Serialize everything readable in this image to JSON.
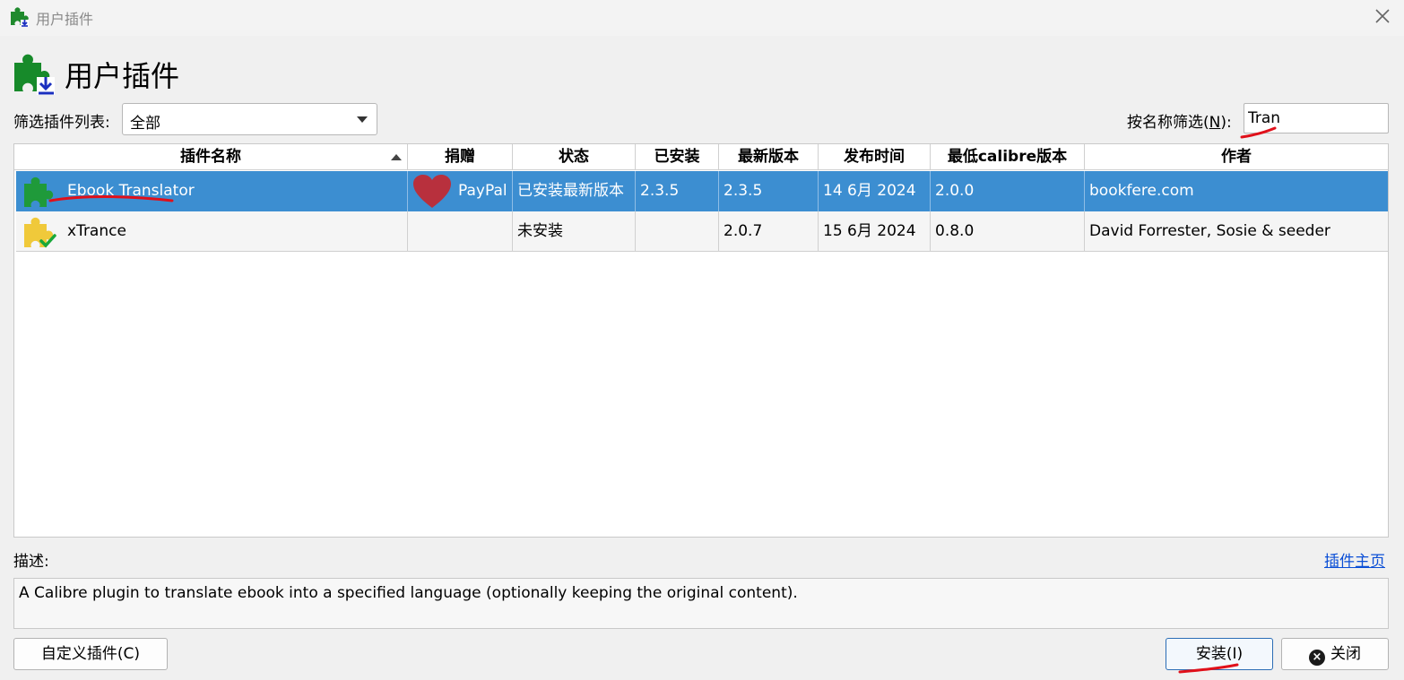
{
  "window": {
    "title": "用户插件",
    "close_icon": "close-icon"
  },
  "header": {
    "title": "用户插件",
    "icon": "puzzle-download-icon"
  },
  "filter": {
    "label": "筛选插件列表:",
    "selected": "全部"
  },
  "name_filter": {
    "label_prefix": "按名称筛选(",
    "label_key": "N",
    "label_suffix": "):",
    "value": "Tran"
  },
  "table": {
    "columns": [
      "插件名称",
      "捐赠",
      "状态",
      "已安装",
      "最新版本",
      "发布时间",
      "最低calibre版本",
      "作者"
    ],
    "sort_column": "插件名称",
    "rows": [
      {
        "name": "Ebook Translator",
        "donate": "PayPal",
        "status": "已安装最新版本",
        "installed": "2.3.5",
        "latest": "2.3.5",
        "released": "14 6月 2024",
        "min_calibre": "2.0.0",
        "author": "bookfere.com",
        "selected": true,
        "icon": "puzzle-green-icon"
      },
      {
        "name": "xTrance",
        "donate": "",
        "status": "未安装",
        "installed": "",
        "latest": "2.0.7",
        "released": "15 6月 2024",
        "min_calibre": "0.8.0",
        "author": "David Forrester, Sosie & seeder",
        "selected": false,
        "icon": "puzzle-yellow-check-icon"
      }
    ]
  },
  "description": {
    "label": "描述:",
    "homepage_link": "插件主页",
    "text": "A Calibre plugin to translate ebook into a specified language (optionally keeping the original content)."
  },
  "buttons": {
    "customize": "自定义插件(C)",
    "install": "安装(I)",
    "close": "关闭"
  },
  "colors": {
    "selection": "#3c8ed1",
    "annotation_red": "#e0101a",
    "link": "#0b4fd6"
  }
}
